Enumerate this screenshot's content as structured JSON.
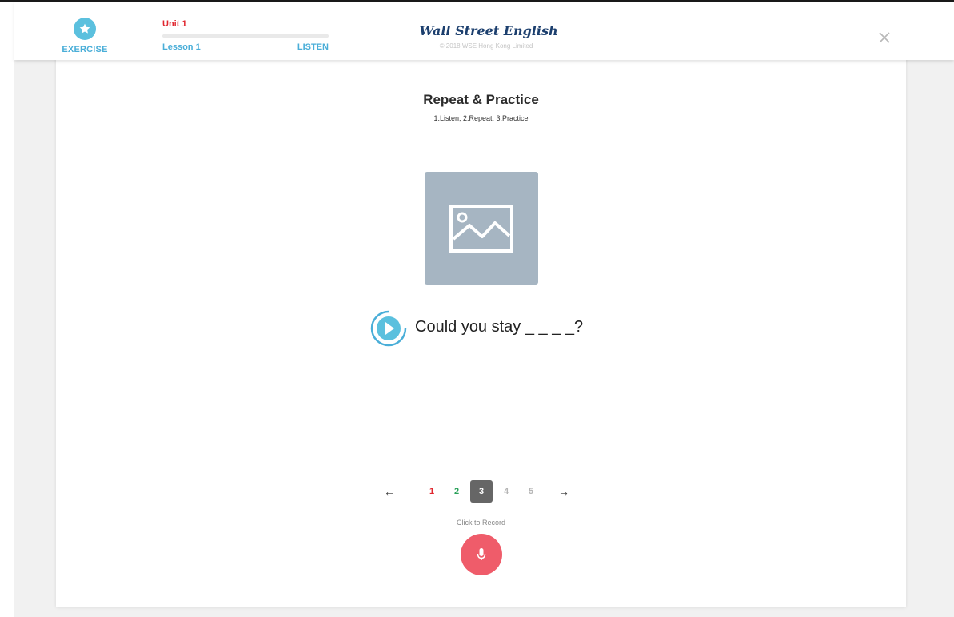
{
  "header": {
    "exercise": {
      "label": "EXERCISE",
      "icon": "star-icon",
      "color": "#5bc0de"
    },
    "progress": {
      "unit": "Unit 1",
      "lesson": "Lesson 1",
      "stage": "LISTEN",
      "fill_fraction": 0.0
    },
    "brand": {
      "wordmark": "Wall Street English",
      "copyright": "© 2018 WSE Hong Kong Limited",
      "logo_icon": "wse-logo-icon"
    },
    "close_icon": "close-icon"
  },
  "exercise": {
    "title": "Repeat & Practice",
    "instructions": "1.Listen, 2.Repeat, 3.Practice",
    "image_icon": "image-placeholder-icon",
    "sentence": "Could you stay _ _ _ _?",
    "play_icon": "play-icon"
  },
  "pagination": {
    "prev_symbol": "←",
    "next_symbol": "→",
    "pages": [
      {
        "label": "1",
        "state": "incorrect",
        "color": "#e0262e"
      },
      {
        "label": "2",
        "state": "correct",
        "color": "#2aa15a"
      },
      {
        "label": "3",
        "state": "current",
        "color": "#ffffff"
      },
      {
        "label": "4",
        "state": "pending",
        "color": "#b5b5b5"
      },
      {
        "label": "5",
        "state": "pending",
        "color": "#b5b5b5"
      }
    ]
  },
  "record": {
    "label": "Click to Record",
    "icon": "microphone-icon",
    "color": "#ef5c6a"
  }
}
